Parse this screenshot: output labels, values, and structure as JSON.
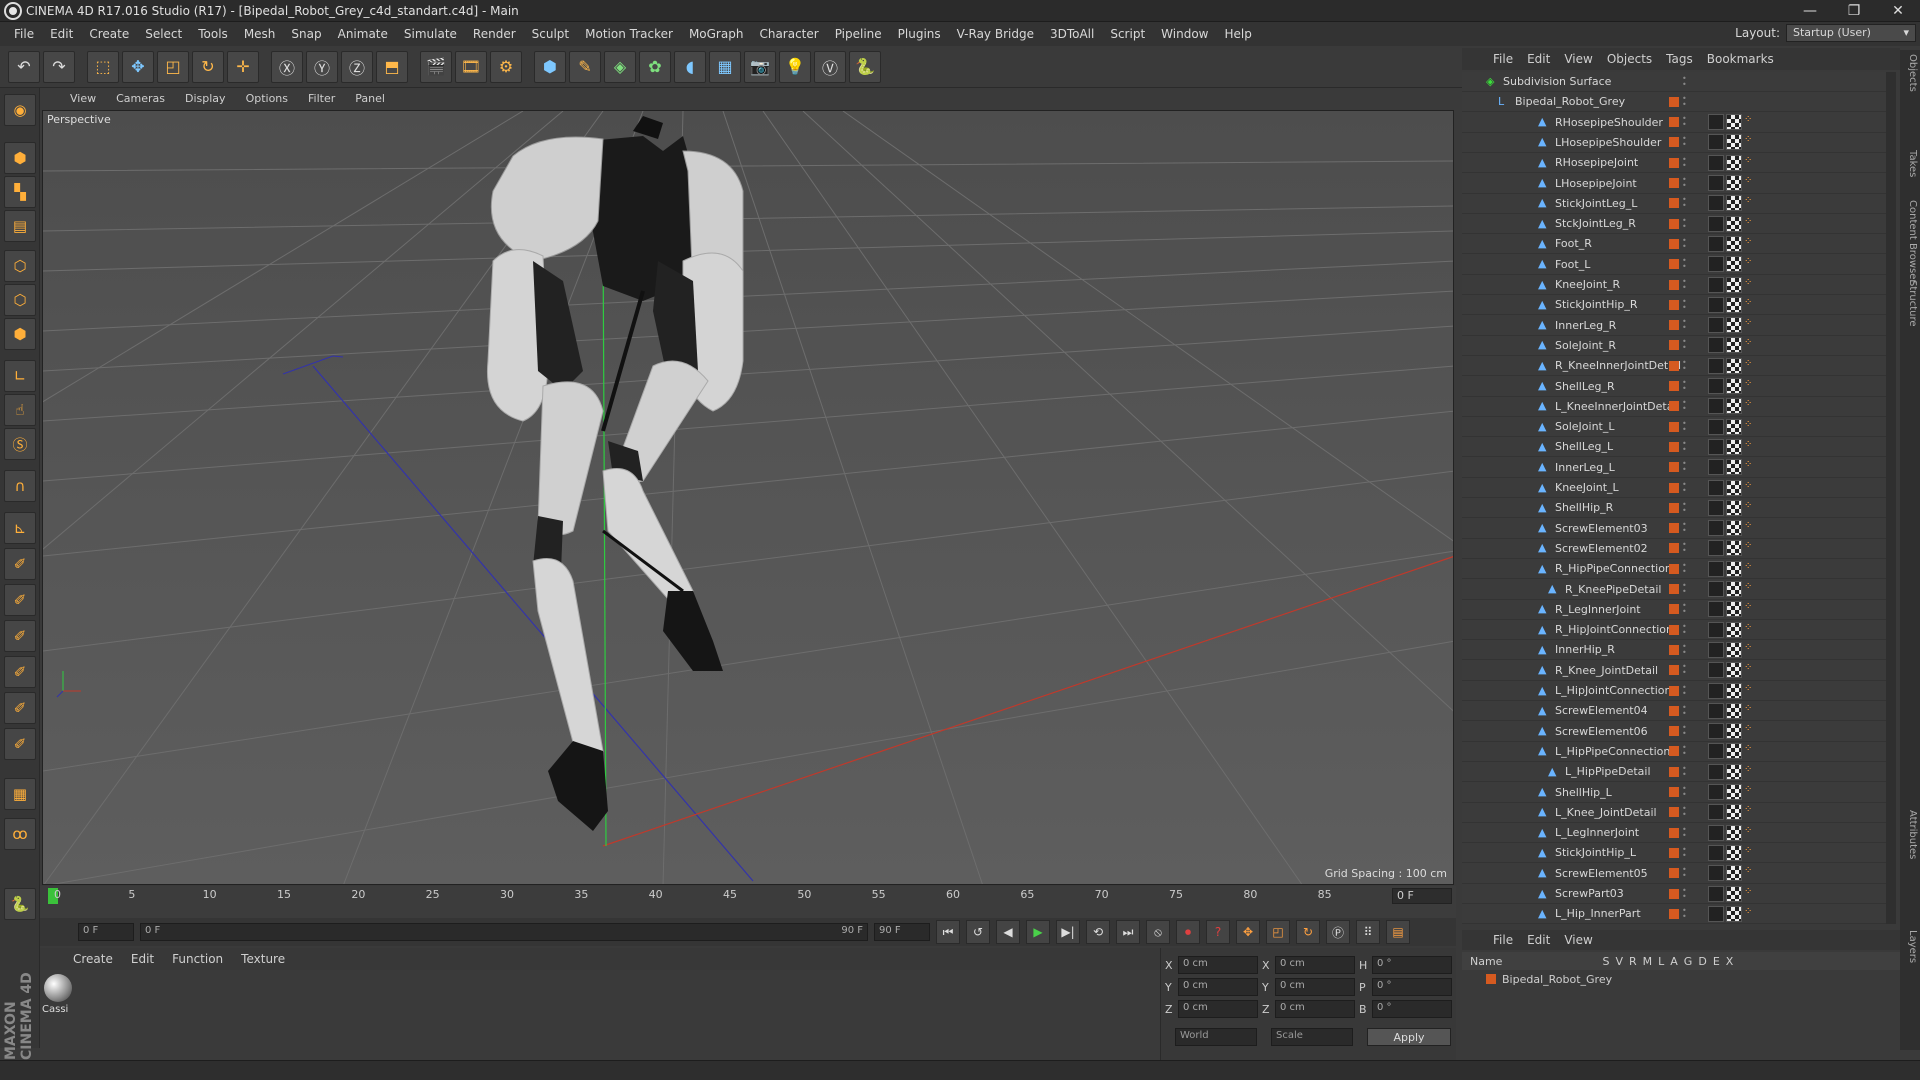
{
  "window": {
    "title": "CINEMA 4D R17.016 Studio (R17) - [Bipedal_Robot_Grey_c4d_standart.c4d] - Main",
    "controls": [
      "—",
      "❐",
      "✕"
    ]
  },
  "menu": [
    "File",
    "Edit",
    "Create",
    "Select",
    "Tools",
    "Mesh",
    "Snap",
    "Animate",
    "Simulate",
    "Render",
    "Sculpt",
    "Motion Tracker",
    "MoGraph",
    "Character",
    "Pipeline",
    "Plugins",
    "V-Ray Bridge",
    "3DToAll",
    "Script",
    "Window",
    "Help"
  ],
  "layout": {
    "label": "Layout:",
    "value": "Startup (User)"
  },
  "viewport": {
    "menu": [
      "View",
      "Cameras",
      "Display",
      "Options",
      "Filter",
      "Panel"
    ],
    "label": "Perspective",
    "grid_spacing": "Grid Spacing : 100 cm"
  },
  "timeline": {
    "ticks": [
      "0",
      "5",
      "10",
      "15",
      "20",
      "25",
      "30",
      "35",
      "40",
      "45",
      "50",
      "55",
      "60",
      "65",
      "70",
      "75",
      "80",
      "85",
      "90"
    ],
    "current_frame": "0 F",
    "start_field": "0 F",
    "range_start": "0 F",
    "range_end": "90 F",
    "end_field": "90 F"
  },
  "material_manager": {
    "menu": [
      "Create",
      "Edit",
      "Function",
      "Texture"
    ],
    "materials": [
      {
        "name": "Cassi"
      }
    ]
  },
  "coordinates": {
    "rows": [
      {
        "a": "X",
        "av": "0 cm",
        "b": "X",
        "bv": "0 cm",
        "c": "H",
        "cv": "0 °"
      },
      {
        "a": "Y",
        "av": "0 cm",
        "b": "Y",
        "bv": "0 cm",
        "c": "P",
        "cv": "0 °"
      },
      {
        "a": "Z",
        "av": "0 cm",
        "b": "Z",
        "bv": "0 cm",
        "c": "B",
        "cv": "0 °"
      }
    ],
    "mode": "World",
    "scale": "Scale",
    "apply": "Apply"
  },
  "objects_panel": {
    "menu": [
      "File",
      "Edit",
      "View",
      "Objects",
      "Tags",
      "Bookmarks"
    ],
    "items": [
      "Subdivision Surface",
      "Bipedal_Robot_Grey",
      "RHosepipeShoulder",
      "LHosepipeShoulder",
      "RHosepipeJoint",
      "LHosepipeJoint",
      "StickJointLeg_L",
      "StckJointLeg_R",
      "Foot_R",
      "Foot_L",
      "KneeJoint_R",
      "StickJointHip_R",
      "InnerLeg_R",
      "SoleJoint_R",
      "R_KneeInnerJointDetail",
      "ShellLeg_R",
      "L_KneeInnerJointDetail",
      "SoleJoint_L",
      "ShellLeg_L",
      "InnerLeg_L",
      "KneeJoint_L",
      "ShellHip_R",
      "ScrewElement03",
      "ScrewElement02",
      "R_HipPipeConnection",
      "R_KneePipeDetail",
      "R_LegInnerJoint",
      "R_HipJointConnection",
      "InnerHip_R",
      "R_Knee_JointDetail",
      "L_HipJointConnection",
      "ScrewElement04",
      "ScrewElement06",
      "L_HipPipeConnection",
      "L_HipPipeDetail",
      "ShellHip_L",
      "L_Knee_JointDetail",
      "L_LegInnerJoint",
      "StickJointHip_L",
      "ScrewElement05",
      "ScrewPart03",
      "L_Hip_InnerPart"
    ]
  },
  "layers_panel": {
    "menu": [
      "File",
      "Edit",
      "View"
    ],
    "columns": [
      "Name",
      "S",
      "V",
      "R",
      "M",
      "L",
      "A",
      "G",
      "D",
      "E",
      "X"
    ],
    "layers": [
      "Bipedal_Robot_Grey"
    ]
  },
  "right_tabs": [
    "Objects",
    "Takes",
    "Content Browser",
    "Structure",
    "Attributes",
    "Layers"
  ],
  "brand": "MAXON CINEMA 4D",
  "colors": {
    "layer": "#d55a20",
    "playhead": "#3bc23b",
    "axis_x": "#c0392b",
    "axis_y": "#2ecc40",
    "axis_z": "#3333aa"
  }
}
